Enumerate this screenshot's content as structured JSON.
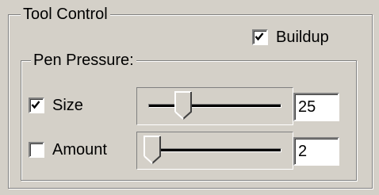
{
  "tool_control": {
    "title": "Tool Control",
    "buildup": {
      "label": "Buildup",
      "checked": true
    }
  },
  "pen_pressure": {
    "title": "Pen Pressure:",
    "size": {
      "label": "Size",
      "checked": true,
      "value": "25",
      "slider_fraction": 0.25
    },
    "amount": {
      "label": "Amount",
      "checked": false,
      "value": "2",
      "slider_fraction": 0.02
    }
  }
}
